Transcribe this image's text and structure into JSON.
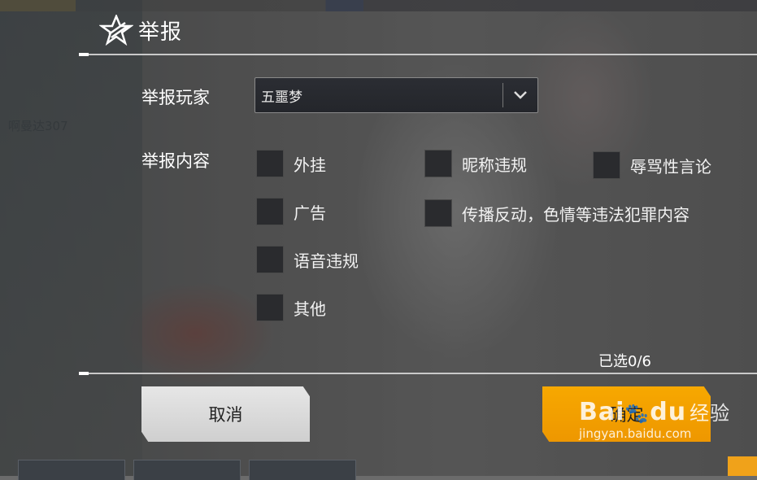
{
  "dialog": {
    "title": "举报"
  },
  "form": {
    "player_label": "举报玩家",
    "player_value": "五噩梦",
    "content_label": "举报内容",
    "options": [
      {
        "label": "外挂",
        "checked": false
      },
      {
        "label": "昵称违规",
        "checked": false
      },
      {
        "label": "辱骂性言论",
        "checked": false
      },
      {
        "label": "广告",
        "checked": false
      },
      {
        "label": "传播反动，色情等违法犯罪内容",
        "checked": false
      },
      {
        "label": "语音违规",
        "checked": false
      },
      {
        "label": "其他",
        "checked": false
      }
    ],
    "selected_count": "已选0/6"
  },
  "buttons": {
    "cancel": "取消",
    "confirm": "确定"
  },
  "background": {
    "faded_name": "啊曼达307"
  },
  "watermark": {
    "brand_left": "Bai",
    "brand_right": "du",
    "brand_cn": "经验",
    "url": "jingyan.baidu.com"
  },
  "colors": {
    "confirm": "#f2a000",
    "cancel": "#dcdcdc",
    "checkbox": "#2a2b2e"
  }
}
